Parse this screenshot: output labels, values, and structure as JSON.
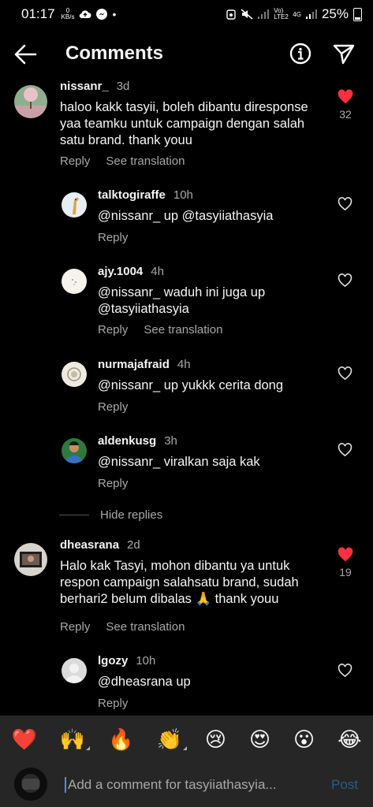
{
  "status_bar": {
    "time": "01:17",
    "kbs_value": "0",
    "kbs_unit": "KB/s",
    "network_label_1": "Vo) LTE2",
    "network_label_2": "4G",
    "battery": "25%"
  },
  "header": {
    "title": "Comments"
  },
  "comments": [
    {
      "username": "nissanr_",
      "time": "3d",
      "text_lines": [
        "haloo kakk tasyii, boleh dibantu diresponse",
        "yaa teamku untuk campaign dengan salah",
        "satu brand. thank youu"
      ],
      "reply": "Reply",
      "translate": "See translation",
      "likes": "32",
      "liked": true
    },
    {
      "username": "dheasrana",
      "time": "2d",
      "text_lines": [
        "Halo kak Tasyi, mohon dibantu ya untuk",
        "respon campaign salahsatu brand, sudah",
        "berhari2 belum dibalas 🙏 thank youu"
      ],
      "reply": "Reply",
      "translate": "See translation",
      "likes": "19",
      "liked": true
    }
  ],
  "replies": [
    {
      "username": "talktogiraffe",
      "time": "10h",
      "text_lines": [
        "@nissanr_ up @tasyiiathasyia"
      ],
      "reply": "Reply",
      "translate": ""
    },
    {
      "username": "ajy.1004",
      "time": "4h",
      "text_lines": [
        "@nissanr_ waduh ini juga up",
        "@tasyiiathasyia"
      ],
      "reply": "Reply",
      "translate": "See translation"
    },
    {
      "username": "nurmajafraid",
      "time": "4h",
      "text_lines": [
        "@nissanr_ up yukkk cerita dong"
      ],
      "reply": "Reply",
      "translate": ""
    },
    {
      "username": "aldenkusg",
      "time": "3h",
      "text_lines": [
        "@nissanr_ viralkan saja kak"
      ],
      "reply": "Reply",
      "translate": ""
    },
    {
      "username": "lgozy",
      "time": "10h",
      "text_lines": [
        "@dheasrana up"
      ],
      "reply": "Reply",
      "translate": ""
    }
  ],
  "hide_replies": "Hide replies",
  "emoji_bar": [
    "❤️",
    "🙌",
    "🔥",
    "👏",
    "😢",
    "😍",
    "😮",
    "😂"
  ],
  "composer": {
    "placeholder": "Add a comment for tasyiiathasyia...",
    "post_label": "Post"
  },
  "colors": {
    "background": "#000000",
    "heart_liked": "#ff3040",
    "secondary_text": "#a8a8a8",
    "post_disabled": "#2b5a8a",
    "composer_bg": "#262626"
  }
}
